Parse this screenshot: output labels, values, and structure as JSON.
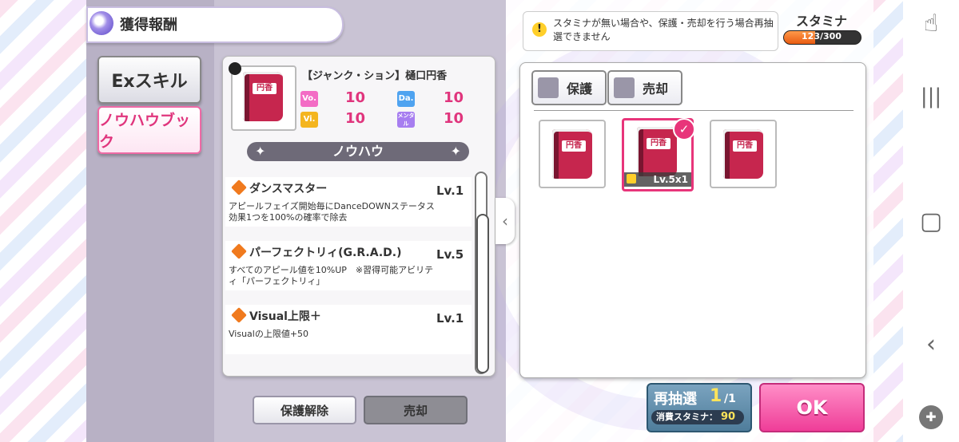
{
  "title": "獲得報酬",
  "tabs": [
    {
      "label": "Exスキル"
    },
    {
      "label": "ノウハウブック"
    }
  ],
  "item": {
    "name": "【ジャンク・ション】樋口円香",
    "book_label": "円香",
    "stats": [
      {
        "key": "Vo.",
        "value": "10",
        "color": "#f36cc5"
      },
      {
        "key": "Da.",
        "value": "10",
        "color": "#4fa3f0"
      },
      {
        "key": "Vi.",
        "value": "10",
        "color": "#f4b51f"
      },
      {
        "key": "メンタル",
        "value": "10",
        "color": "#a77ef0"
      }
    ]
  },
  "section_title": "ノウハウ",
  "skills": [
    {
      "name": "ダンスマスター",
      "level": "Lv.1",
      "desc": "アピールフェイズ開始毎にDanceDOWNステータス効果1つを100%の確率で除去"
    },
    {
      "name": "パーフェクトリィ(G.R.A.D.)",
      "level": "Lv.5",
      "desc": "すべてのアピール値を10%UP　※習得可能アビリティ「パーフェクトリィ」"
    },
    {
      "name": "Visual上限＋",
      "level": "Lv.1",
      "desc": "Visualの上限値+50"
    }
  ],
  "left_buttons": {
    "unlock": "保護解除",
    "sell": "売却"
  },
  "warning": "スタミナが無い場合や、保護・売却を行う場合再抽選できません",
  "stamina": {
    "label": "スタミナ",
    "text": "123/300",
    "current": 123,
    "max": 300
  },
  "filter_tabs": {
    "protect": "保護",
    "sell": "売却"
  },
  "slots": {
    "selected_level": "Lv.5x1",
    "selected_index": 1
  },
  "redraw": {
    "label": "再抽選",
    "count": "1",
    "total": "/1",
    "cost_label": "消費スタミナ：",
    "cost_value": "90"
  },
  "ok_label": "OK"
}
